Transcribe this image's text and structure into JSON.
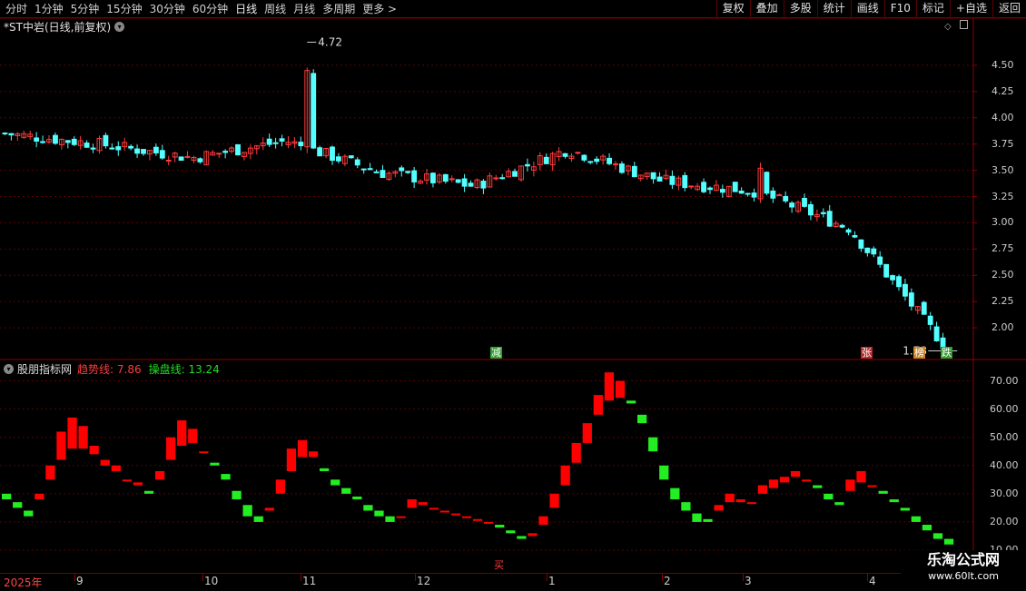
{
  "toolbar": {
    "periods": [
      "分时",
      "1分钟",
      "5分钟",
      "15分钟",
      "30分钟",
      "60分钟",
      "日线",
      "周线",
      "月线",
      "多周期",
      "更多 >"
    ],
    "active_period": "日线",
    "buttons": [
      "复权",
      "叠加",
      "多股",
      "统计",
      "画线",
      "F10",
      "标记",
      "+自选",
      "返回"
    ]
  },
  "stock": {
    "title": "*ST中岩(日线,前复权)"
  },
  "price_axis": {
    "ticks": [
      "4.50",
      "4.25",
      "4.00",
      "3.75",
      "3.50",
      "3.25",
      "3.00",
      "2.75",
      "2.50",
      "2.25",
      "2.00"
    ]
  },
  "annotations": {
    "high": "4.72",
    "low": "1.78"
  },
  "signals": [
    {
      "text": "减",
      "color": "#2e9e2e"
    },
    {
      "text": "张",
      "color": "#b52a2a"
    },
    {
      "text": "榜",
      "color": "#c8831e"
    },
    {
      "text": "跌",
      "color": "#2e9e2e"
    }
  ],
  "indicator": {
    "name": "股朋指标网",
    "trend_label": "趋势线: 7.86",
    "cp_label": "操盘线: 13.24",
    "ticks": [
      "70.00",
      "60.00",
      "50.00",
      "40.00",
      "30.00",
      "20.00",
      "10.00"
    ],
    "buy_marker": "买"
  },
  "dates": {
    "year": "2025年",
    "months": [
      "9",
      "10",
      "11",
      "12",
      "1",
      "2",
      "3",
      "4"
    ]
  },
  "colors": {
    "up": "#ff3b3b",
    "down": "#54ffff",
    "trend_up": "#ff0000",
    "trend_down": "#22ee22",
    "grid": "#6b0000"
  },
  "watermark": {
    "line1": "乐淘公式网",
    "line2": "www.60lt.com"
  },
  "chart_data": [
    {
      "type": "candlestick",
      "title": "*ST中岩(日线,前复权)",
      "ylim": [
        1.75,
        4.75
      ],
      "x": [
        "2025-08",
        "2025-09",
        "2025-10",
        "2025-11",
        "2025-12",
        "2026-01",
        "2026-02",
        "2026-03",
        "2026-04"
      ],
      "close_approx": [
        3.85,
        3.75,
        3.62,
        3.78,
        3.48,
        3.35,
        3.7,
        3.4,
        3.3,
        2.95,
        1.85
      ],
      "high": 4.72,
      "low": 1.78
    },
    {
      "type": "area",
      "title": "股朋指标网",
      "ylim": [
        10,
        75
      ],
      "series": [
        {
          "name": "趋势线",
          "values": [
            28,
            25,
            22,
            30,
            40,
            52,
            57,
            54,
            47,
            42,
            40,
            35,
            34,
            30,
            38,
            50,
            56,
            53,
            45,
            40,
            35,
            28,
            22,
            20,
            25,
            35,
            46,
            49,
            45,
            38,
            33,
            30,
            28,
            24,
            22,
            20,
            22,
            28,
            27,
            25,
            24,
            23,
            22,
            21,
            20,
            18,
            16,
            14,
            16,
            22,
            30,
            40,
            48,
            55,
            65,
            73,
            70,
            62,
            55,
            45,
            35,
            28,
            24,
            20,
            20,
            26,
            30,
            28,
            27,
            33,
            35,
            36,
            38,
            35,
            32,
            28,
            26,
            35,
            38,
            33,
            30,
            27,
            24,
            20,
            17,
            14,
            12
          ]
        },
        {
          "name": "操盘线",
          "values": [
            30,
            27,
            24,
            28,
            35,
            42,
            46,
            46,
            44,
            40,
            38,
            35,
            33,
            31,
            35,
            42,
            47,
            48,
            45,
            41,
            37,
            31,
            26,
            22,
            24,
            30,
            38,
            43,
            43,
            39,
            35,
            32,
            29,
            26,
            24,
            22,
            22,
            25,
            26,
            25,
            24,
            23,
            22,
            21,
            20,
            19,
            17,
            15,
            15,
            19,
            25,
            33,
            41,
            48,
            58,
            63,
            64,
            63,
            58,
            50,
            40,
            32,
            27,
            23,
            21,
            24,
            27,
            27,
            27,
            30,
            32,
            34,
            36,
            35,
            33,
            30,
            27,
            31,
            34,
            33,
            31,
            28,
            25,
            22,
            19,
            16,
            14
          ]
        }
      ]
    }
  ]
}
